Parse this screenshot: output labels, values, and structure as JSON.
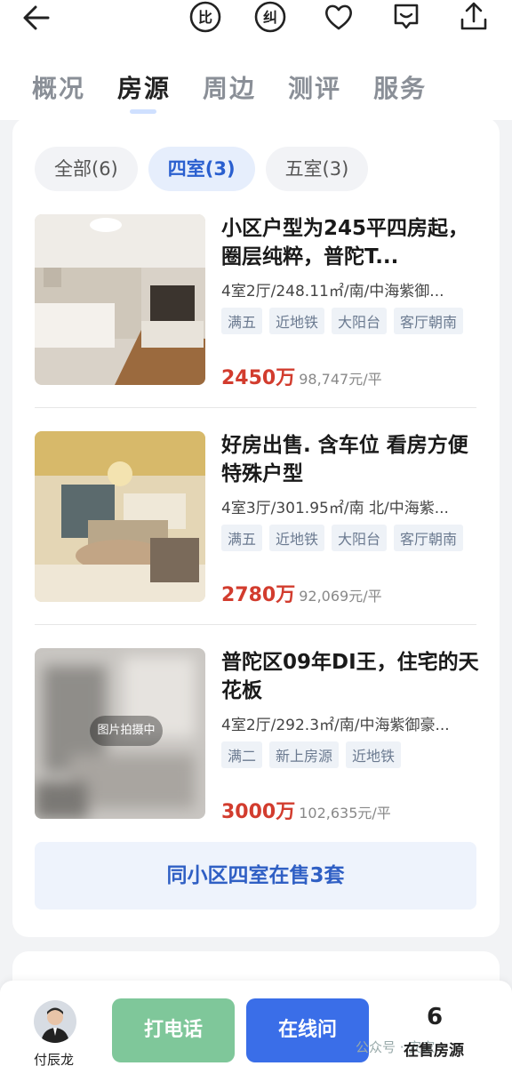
{
  "header": {
    "tabs": [
      {
        "label": "概况"
      },
      {
        "label": "房源"
      },
      {
        "label": "周边"
      },
      {
        "label": "测评"
      },
      {
        "label": "服务"
      }
    ],
    "icons": [
      "back-arrow-icon",
      "compare-icon",
      "report-icon",
      "favorite-heart-icon",
      "message-icon",
      "share-icon"
    ]
  },
  "filters": [
    {
      "label": "全部(6)"
    },
    {
      "label": "四室(3)"
    },
    {
      "label": "五室(3)"
    }
  ],
  "listings": [
    {
      "title": "小区户型为245平四房起，圈层纯粹，普陀T...",
      "meta": "4室2厅/248.11㎡/南/中海紫御...",
      "tags": [
        "满五",
        "近地铁",
        "大阳台",
        "客厅朝南"
      ],
      "price": "2450万",
      "unit_price": "98,747元/平"
    },
    {
      "title": "好房出售. 含车位 看房方便 特殊户型",
      "meta": "4室3厅/301.95㎡/南 北/中海紫...",
      "tags": [
        "满五",
        "近地铁",
        "大阳台",
        "客厅朝南"
      ],
      "price": "2780万",
      "unit_price": "92,069元/平"
    },
    {
      "title": "普陀区09年DI王，住宅的天花板",
      "meta": "4室2厅/292.3㎡/南/中海紫御豪...",
      "tags": [
        "满二",
        "新上房源",
        "近地铁"
      ],
      "price": "3000万",
      "unit_price": "102,635元/平",
      "photo_badge": "图片拍摄中"
    }
  ],
  "more_button": "同小区四室在售3套",
  "bottom": {
    "agent_name": "付辰龙",
    "call_label": "打电话",
    "chat_label": "在线问",
    "count": "6",
    "count_label": "在售房源",
    "watermark": "公众号 · 安家"
  }
}
